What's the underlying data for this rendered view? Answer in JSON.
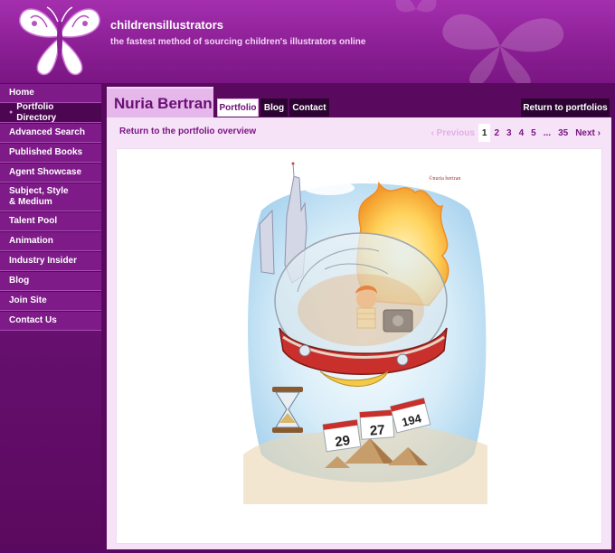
{
  "site": {
    "name": "childrensillustrators",
    "tagline": "the fastest method of sourcing children's illustrators online"
  },
  "sidebar": {
    "items": [
      {
        "label": "Home",
        "active": false
      },
      {
        "label": "Portfolio Directory",
        "active": true
      },
      {
        "label": "Advanced Search",
        "active": false
      },
      {
        "label": "Published Books",
        "active": false
      },
      {
        "label": "Agent Showcase",
        "active": false
      },
      {
        "label": "Subject, Style\n& Medium",
        "active": false
      },
      {
        "label": "Talent Pool",
        "active": false
      },
      {
        "label": "Animation",
        "active": false
      },
      {
        "label": "Industry Insider",
        "active": false
      },
      {
        "label": "Blog",
        "active": false
      },
      {
        "label": "Join Site",
        "active": false
      },
      {
        "label": "Contact Us",
        "active": false
      }
    ]
  },
  "artist": {
    "name": "Nuria Bertran"
  },
  "tabs": [
    {
      "label": "Portfolio",
      "active": true
    },
    {
      "label": "Blog",
      "active": false
    },
    {
      "label": "Contact",
      "active": false
    }
  ],
  "return_portfolios": "Return to portfolios",
  "overview_link": "Return to the portfolio overview",
  "pager": {
    "previous": "‹ Previous",
    "pages": [
      "1",
      "2",
      "3",
      "4",
      "5"
    ],
    "ellipsis": "...",
    "last": "35",
    "next": "Next ›",
    "current": "1"
  },
  "illustration": {
    "signature": "©nuria bertran",
    "calendar_numbers": [
      "29",
      "27",
      "194"
    ]
  },
  "colors": {
    "brand_purple": "#8c1f95",
    "dark_nav": "#2c0432",
    "content_bg": "#f7e3f8"
  }
}
